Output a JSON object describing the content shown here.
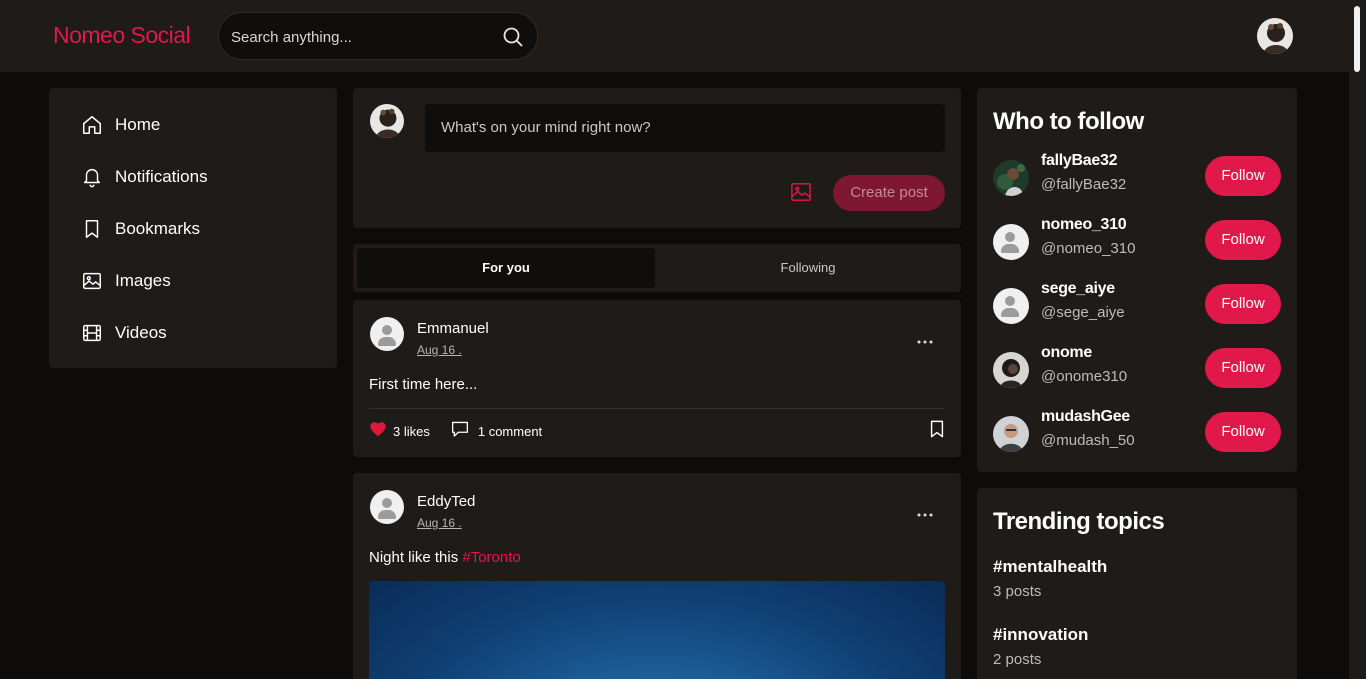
{
  "app": {
    "brand": "Nomeo Social",
    "brand_color": "#e0194a"
  },
  "search": {
    "placeholder": "Search anything..."
  },
  "nav": {
    "items": [
      {
        "label": "Home",
        "icon": "home-icon"
      },
      {
        "label": "Notifications",
        "icon": "bell-icon"
      },
      {
        "label": "Bookmarks",
        "icon": "bookmark-icon"
      },
      {
        "label": "Images",
        "icon": "image-icon"
      },
      {
        "label": "Videos",
        "icon": "film-icon"
      }
    ]
  },
  "composer": {
    "placeholder": "What's on your mind right now?",
    "create_label": "Create post"
  },
  "tabs": [
    {
      "label": "For you",
      "active": true
    },
    {
      "label": "Following",
      "active": false
    }
  ],
  "posts": [
    {
      "author": "Emmanuel",
      "date": "Aug 16 .",
      "text": "First time here...",
      "likes": "3 likes",
      "comments": "1 comment"
    },
    {
      "author": "EddyTed",
      "date": "Aug 16 .",
      "text": "Night like this ",
      "hashtag": "#Toronto"
    }
  ],
  "who_to_follow": {
    "title": "Who to follow",
    "button_label": "Follow",
    "users": [
      {
        "name": "fallyBae32",
        "handle": "@fallyBae32"
      },
      {
        "name": "nomeo_310",
        "handle": "@nomeo_310"
      },
      {
        "name": "sege_aiye",
        "handle": "@sege_aiye"
      },
      {
        "name": "onome",
        "handle": "@onome310"
      },
      {
        "name": "mudashGee",
        "handle": "@mudash_50"
      }
    ]
  },
  "trending": {
    "title": "Trending topics",
    "topics": [
      {
        "tag": "#mentalhealth",
        "count": "3 posts"
      },
      {
        "tag": "#innovation",
        "count": "2 posts"
      }
    ]
  }
}
